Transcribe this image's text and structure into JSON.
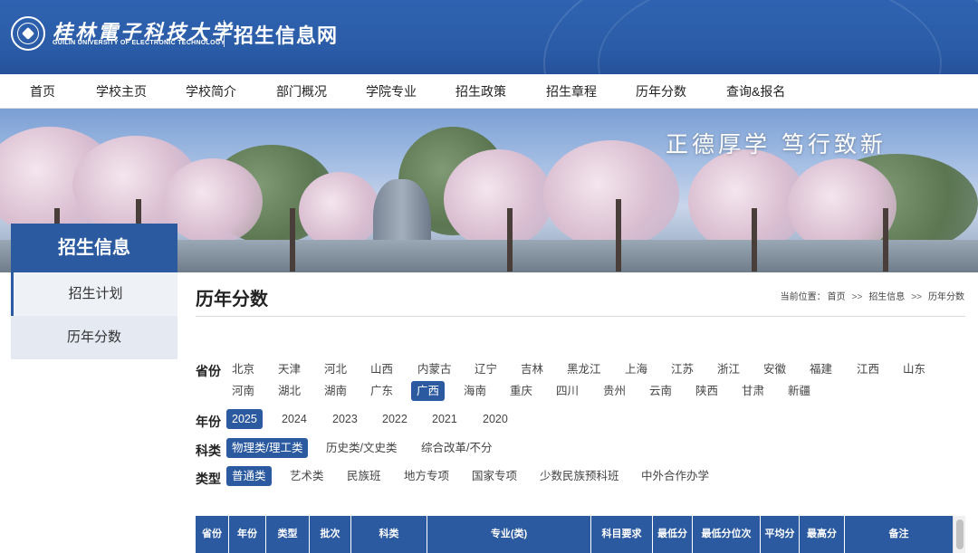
{
  "header": {
    "university_cn": "桂林電子科技大学",
    "university_en": "GUILIN UNIVERSITY OF ELECTRONIC TECHNOLOGY",
    "site_title": "招生信息网"
  },
  "nav": [
    "首页",
    "学校主页",
    "学校简介",
    "部门概况",
    "学院专业",
    "招生政策",
    "招生章程",
    "历年分数",
    "查询&报名"
  ],
  "banner": {
    "slogan": "正德厚学  笃行致新"
  },
  "sidebar": {
    "heading": "招生信息",
    "items": [
      {
        "label": "招生计划"
      },
      {
        "label": "历年分数"
      }
    ]
  },
  "main": {
    "title": "历年分数",
    "breadcrumb": {
      "prefix": "当前位置：",
      "items": [
        "首页",
        "招生信息",
        "历年分数"
      ],
      "sep": ">>"
    }
  },
  "filters": {
    "province": {
      "label": "省份",
      "row1": [
        "北京",
        "天津",
        "河北",
        "山西",
        "内蒙古",
        "辽宁",
        "吉林",
        "黑龙江",
        "上海",
        "江苏",
        "浙江",
        "安徽",
        "福建",
        "江西",
        "山东"
      ],
      "row2": [
        "河南",
        "湖北",
        "湖南",
        "广东",
        "广西",
        "海南",
        "重庆",
        "四川",
        "贵州",
        "云南",
        "陕西",
        "甘肃",
        "新疆"
      ],
      "selected": "广西"
    },
    "year": {
      "label": "年份",
      "options": [
        "2025",
        "2024",
        "2023",
        "2022",
        "2021",
        "2020"
      ],
      "selected": "2025"
    },
    "subject": {
      "label": "科类",
      "options": [
        "物理类/理工类",
        "历史类/文史类",
        "综合改革/不分"
      ],
      "selected": "物理类/理工类"
    },
    "type": {
      "label": "类型",
      "options": [
        "普通类",
        "艺术类",
        "民族班",
        "地方专项",
        "国家专项",
        "少数民族预科班",
        "中外合作办学"
      ],
      "selected": "普通类"
    }
  },
  "table": {
    "headers": [
      "省份",
      "年份",
      "类型",
      "批次",
      "科类",
      "专业(类)",
      "科目要求",
      "最低分",
      "最低分位次",
      "平均分",
      "最高分",
      "备注"
    ]
  },
  "colors": {
    "primary": "#2c5aa0",
    "header_bg": "#2f63b1",
    "sidebar_bg": "#e9edf4"
  }
}
